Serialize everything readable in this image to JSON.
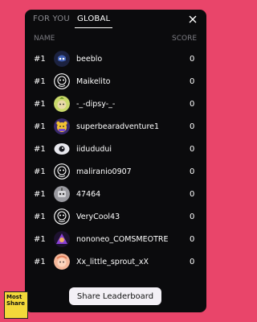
{
  "tabs": {
    "for_you": "FOR YOU",
    "global": "GLOBAL"
  },
  "columns": {
    "name": "NAME",
    "score": "SCORE"
  },
  "rows": [
    {
      "rank": "#1",
      "username": "beeblo",
      "score": "0",
      "avatar": "dark-blue-character-avatar"
    },
    {
      "rank": "#1",
      "username": "Maikelito",
      "score": "0",
      "avatar": "default-robot-avatar"
    },
    {
      "rank": "#1",
      "username": "-_-dipsy-_-",
      "score": "0",
      "avatar": "green-character-avatar"
    },
    {
      "rank": "#1",
      "username": "superbearadventure1",
      "score": "0",
      "avatar": "purple-bear-avatar"
    },
    {
      "rank": "#1",
      "username": "iidududui",
      "score": "0",
      "avatar": "eye-avatar"
    },
    {
      "rank": "#1",
      "username": "maliranio0907",
      "score": "0",
      "avatar": "default-robot-avatar"
    },
    {
      "rank": "#1",
      "username": "47464",
      "score": "0",
      "avatar": "gray-robot-avatar"
    },
    {
      "rank": "#1",
      "username": "VeryCool43",
      "score": "0",
      "avatar": "default-robot-avatar"
    },
    {
      "rank": "#1",
      "username": "nononeo_COMSMEOTRE",
      "score": "0",
      "avatar": "purple-character-avatar"
    },
    {
      "rank": "#1",
      "username": "Xx_little_sprout_xX",
      "score": "0",
      "avatar": "peach-character-avatar"
    }
  ],
  "share_button": "Share Leaderboard",
  "sticker": {
    "line1": "Most",
    "line2": "Share"
  },
  "colors": {
    "background": "#e9456a",
    "panel": "#0b0b0d",
    "button": "#f3f0f6"
  }
}
